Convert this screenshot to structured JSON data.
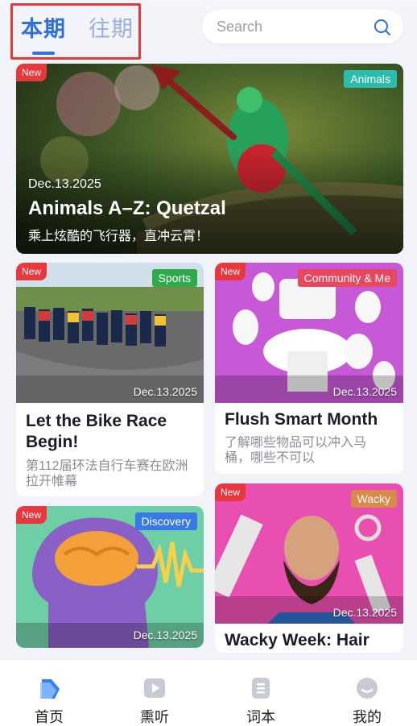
{
  "header": {
    "tabs": [
      {
        "label": "本期",
        "active": true
      },
      {
        "label": "往期",
        "active": false
      }
    ],
    "search": {
      "placeholder": "Search"
    }
  },
  "hero": {
    "badge": "New",
    "category": "Animals",
    "date": "Dec.13.2025",
    "title": "Animals A–Z: Quetzal",
    "subtitle": "乘上炫酷的飞行器，直冲云霄！"
  },
  "cards": [
    {
      "badge": "New",
      "category": "Sports",
      "category_color": "#2eaa4a",
      "date": "Dec.13.2025",
      "title": "Let the Bike Race Begin!",
      "subtitle": "第112届环法自行车赛在欧洲拉开帷幕"
    },
    {
      "badge": "New",
      "category": "Community & Me",
      "category_color": "#e8485e",
      "date": "Dec.13.2025",
      "title": "Flush Smart Month",
      "subtitle": "了解哪些物品可以冲入马桶，哪些不可以"
    },
    {
      "badge": "New",
      "category": "Discovery",
      "category_color": "#3b78e7",
      "date": "Dec.13.2025",
      "title": "",
      "subtitle": ""
    },
    {
      "badge": "New",
      "category": "Wacky",
      "category_color": "#d98a4a",
      "date": "Dec.13.2025",
      "title": "Wacky Week: Hair",
      "subtitle": ""
    }
  ],
  "bottom_nav": [
    {
      "label": "首页",
      "icon": "home-icon",
      "active": true
    },
    {
      "label": "熏听",
      "icon": "play-icon",
      "active": false
    },
    {
      "label": "词本",
      "icon": "notebook-icon",
      "active": false
    },
    {
      "label": "我的",
      "icon": "profile-icon",
      "active": false
    }
  ],
  "colors": {
    "accent": "#2f6fe0",
    "annotation": "#e23b3b",
    "new_badge": "#e8383d",
    "animals_badge": "#2bbcae"
  }
}
